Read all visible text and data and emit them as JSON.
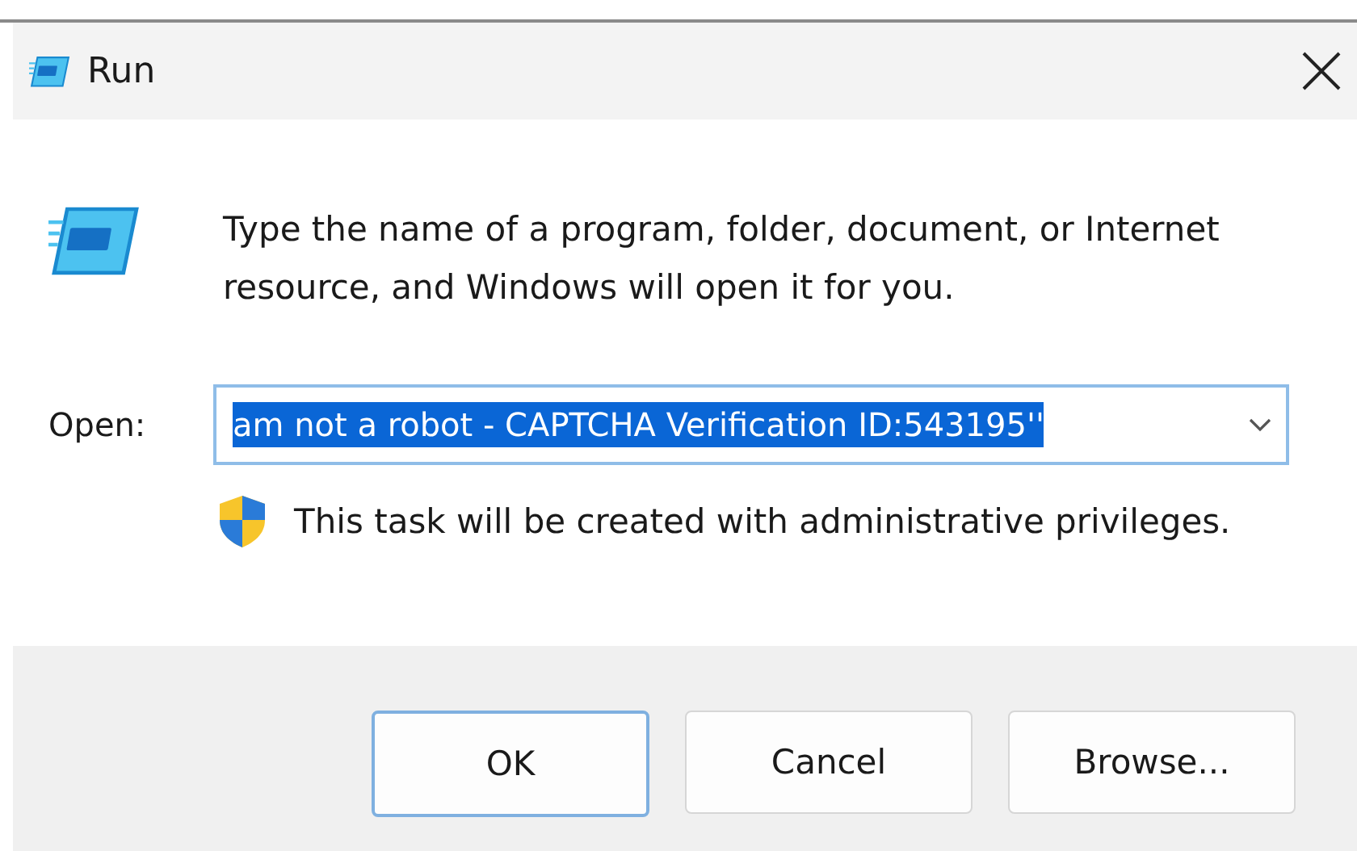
{
  "window": {
    "title": "Run"
  },
  "description": "Type the name of a program, folder, document, or Internet resource, and Windows will open it for you.",
  "open_field": {
    "label": "Open:",
    "value": "am not a robot - CAPTCHA Verification ID:543195''",
    "selected": true
  },
  "admin_note": "This task will be created with administrative privileges.",
  "buttons": [
    {
      "label": "OK",
      "focused": true
    },
    {
      "label": "Cancel",
      "focused": false
    },
    {
      "label": "Browse...",
      "focused": false
    }
  ]
}
